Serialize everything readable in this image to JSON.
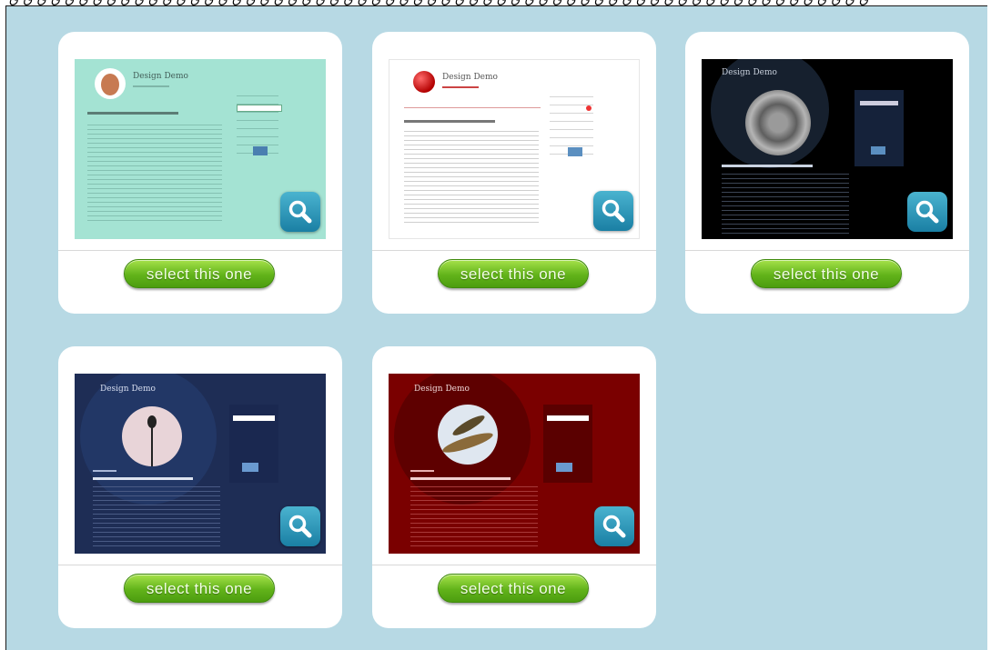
{
  "cards": [
    {
      "thumb_title": "Design Demo",
      "button_label": "select this one",
      "theme": "mint"
    },
    {
      "thumb_title": "Design Demo",
      "button_label": "select this one",
      "theme": "white"
    },
    {
      "thumb_title": "Design Demo",
      "button_label": "select this one",
      "theme": "black"
    },
    {
      "thumb_title": "Design Demo",
      "button_label": "select this one",
      "theme": "navy"
    },
    {
      "thumb_title": "Design Demo",
      "button_label": "select this one",
      "theme": "red"
    }
  ],
  "icons": {
    "zoom": "magnifier-icon"
  },
  "colors": {
    "background": "#b7d9e4",
    "button_green": "#62b31a",
    "zoom_blue": "#1a7fa4",
    "mint": "#a4e3d3",
    "navy": "#1e2d55",
    "red": "#7a0000",
    "black": "#000000"
  }
}
